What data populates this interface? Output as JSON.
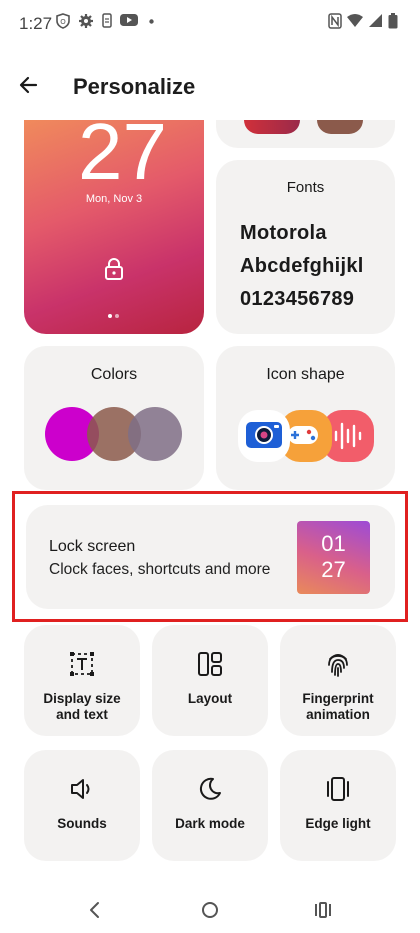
{
  "status_bar": {
    "time": "1:27",
    "left_icons": [
      "shield-icon",
      "gear-icon",
      "sim-icon",
      "youtube-icon",
      "dot-icon"
    ],
    "right_icons": [
      "nfc-icon",
      "wifi-icon",
      "signal-icon",
      "battery-icon"
    ]
  },
  "header": {
    "title": "Personalize"
  },
  "wallpaper_preview": {
    "time": "27",
    "date": "Mon, Nov 3"
  },
  "fonts_card": {
    "label": "Fonts",
    "samples": [
      "Motorola",
      "Abcdefghijkl",
      "0123456789"
    ]
  },
  "colors_card": {
    "label": "Colors",
    "swatches": [
      "#cc00cc",
      "#8b5a4b",
      "#7f6f86"
    ]
  },
  "icon_shape_card": {
    "label": "Icon shape",
    "icons": [
      "camera-icon",
      "game-icon",
      "audio-icon"
    ]
  },
  "lock_screen": {
    "title": "Lock screen",
    "subtitle": "Clock faces, shortcuts and more",
    "thumb_line1": "01",
    "thumb_line2": "27"
  },
  "tiles": [
    {
      "label_line1": "Display size",
      "label_line2": "and text",
      "icon": "text-size-icon"
    },
    {
      "label_line1": "Layout",
      "label_line2": "",
      "icon": "layout-icon"
    },
    {
      "label_line1": "Fingerprint",
      "label_line2": "animation",
      "icon": "fingerprint-icon"
    },
    {
      "label_line1": "Sounds",
      "label_line2": "",
      "icon": "speaker-icon"
    },
    {
      "label_line1": "Dark mode",
      "label_line2": "",
      "icon": "moon-icon"
    },
    {
      "label_line1": "Edge light",
      "label_line2": "",
      "icon": "edge-light-icon"
    }
  ],
  "colors": {
    "accent_highlight": "#e02020",
    "card_bg": "#f3f2f1"
  }
}
